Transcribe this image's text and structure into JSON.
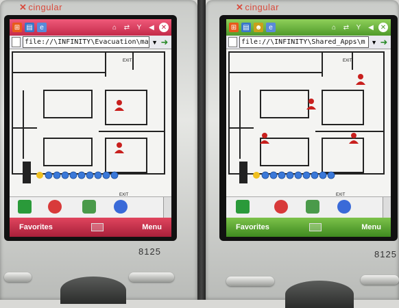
{
  "left_phone": {
    "brand": "cingular",
    "address": "file://\\INFINITY\\Evacuation\\main",
    "softkey_left": "Favorites",
    "softkey_right": "Menu",
    "model": "8125",
    "exit_top": "EXIT",
    "exit_bottom": "EXIT",
    "title_color": "#d8334f"
  },
  "right_phone": {
    "brand": "cingular",
    "address": "file://\\INFINITY\\Shared_Apps\\m",
    "softkey_left": "Favorites",
    "softkey_right": "Menu",
    "model": "8125",
    "exit_top": "EXIT",
    "exit_bottom": "EXIT",
    "title_color": "#5aaa32"
  },
  "icons": [
    "windows-start-icon",
    "home-icon",
    "signal-icon",
    "antenna-icon",
    "speaker-mute-icon",
    "close-icon",
    "go-arrow-icon",
    "play-icon",
    "stop-icon",
    "people-icon",
    "globe-icon",
    "keyboard-icon",
    "person-marker-icon",
    "smiley-icon",
    "arrow-right-icon"
  ]
}
